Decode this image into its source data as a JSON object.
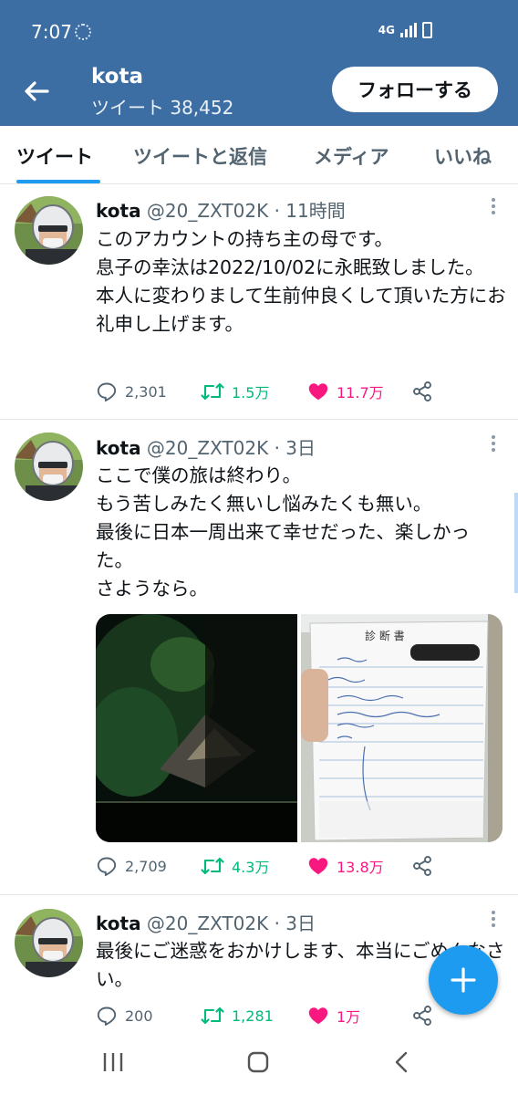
{
  "status_bar": {
    "time": "7:07",
    "network": "4G",
    "icons": [
      "sync-icon",
      "signal-icon",
      "battery-charging-icon"
    ]
  },
  "header": {
    "name": "kota",
    "tweet_count": "ツイート 38,452",
    "follow_label": "フォローする",
    "background_color": "#3d6ea3"
  },
  "tabs": [
    {
      "label": "ツイート",
      "active": true
    },
    {
      "label": "ツイートと返信",
      "active": false
    },
    {
      "label": "メディア",
      "active": false
    },
    {
      "label": "いいね",
      "active": false
    }
  ],
  "tweets": [
    {
      "author": "kota",
      "handle": "@20_ZXT02K",
      "separator": "·",
      "time": "11時間",
      "text": "このアカウントの持ち主の母です。\n息子の幸汰は2022/10/02に永眠致しました。\n本人に変わりまして生前仲良くして頂いた方にお礼申し上げます。",
      "replies": "2,301",
      "retweets": "1.5万",
      "likes": "11.7万"
    },
    {
      "author": "kota",
      "handle": "@20_ZXT02K",
      "separator": "·",
      "time": "3日",
      "text": "ここで僕の旅は終わり。\nもう苦しみたく無いし悩みたくも無い。\n最後に日本一周出来て幸せだった、楽しかった。\nさようなら。",
      "media": {
        "photos": [
          "night-forest-photo",
          "medical-certificate-photo"
        ],
        "document_title": "診 断 書"
      },
      "replies": "2,709",
      "retweets": "4.3万",
      "likes": "13.8万"
    },
    {
      "author": "kota",
      "handle": "@20_ZXT02K",
      "separator": "·",
      "time": "3日",
      "text": "最後にご迷惑をおかけします、本当にごめんなさい。",
      "replies": "200",
      "retweets": "1,281",
      "likes": "1万"
    }
  ],
  "colors": {
    "accent": "#1d9bf0",
    "retweet": "#00ba7c",
    "like": "#f91880",
    "secondary_text": "#536471"
  },
  "nav_bar": {
    "items": [
      "recent-apps-icon",
      "home-icon",
      "back-icon"
    ]
  }
}
